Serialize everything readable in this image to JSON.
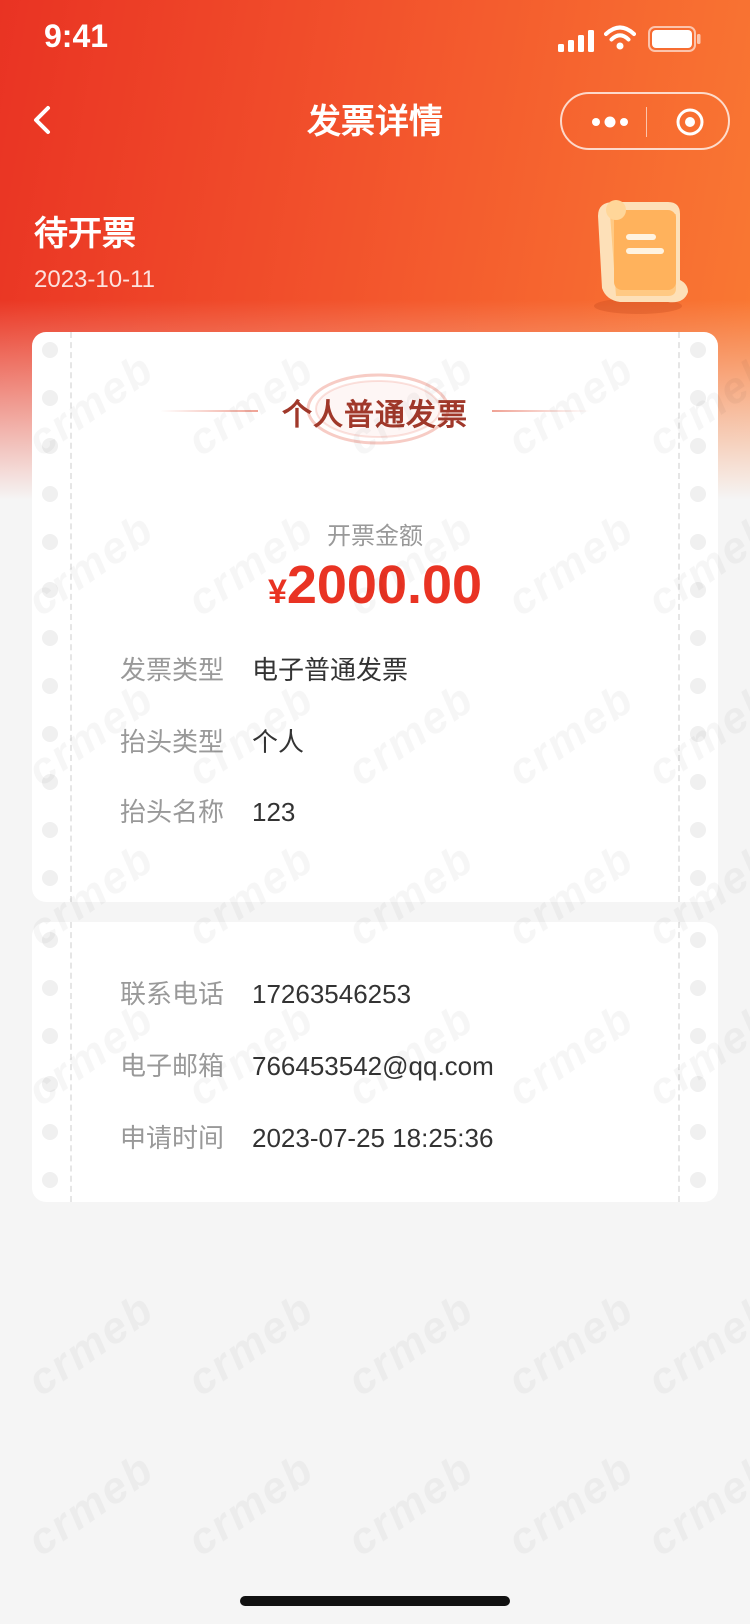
{
  "status_bar": {
    "time": "9:41"
  },
  "nav": {
    "title": "发票详情",
    "back_icon": "chevron-left-icon",
    "more_icon": "more-dots-icon",
    "close_icon": "target-close-icon"
  },
  "header": {
    "status": "待开票",
    "date": "2023-10-11"
  },
  "invoice": {
    "type": "个人普通发票",
    "amount_label": "开票金额",
    "currency_symbol": "¥",
    "amount": "2000.00",
    "fields": [
      {
        "label": "发票类型",
        "value": "电子普通发票"
      },
      {
        "label": "抬头类型",
        "value": "个人"
      },
      {
        "label": "抬头名称",
        "value": "123"
      }
    ]
  },
  "contact": {
    "fields": [
      {
        "label": "联系电话",
        "value": "17263546253"
      },
      {
        "label": "电子邮箱",
        "value": "766453542@qq.com"
      },
      {
        "label": "申请时间",
        "value": "2023-07-25 18:25:36"
      }
    ]
  },
  "watermark": "crmeb",
  "colors": {
    "primary": "#e93323",
    "gradient_end": "#fa7a33",
    "invoice_type": "#a0382a"
  }
}
